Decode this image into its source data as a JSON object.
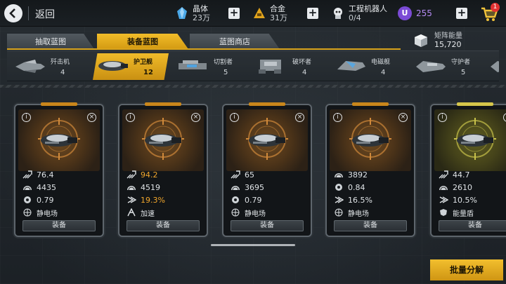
{
  "header": {
    "back_label": "返回",
    "crystal": {
      "name": "晶体",
      "value": "23万"
    },
    "alloy": {
      "name": "合金",
      "value": "31万"
    },
    "robots": {
      "name": "工程机器人",
      "value": "0/4"
    },
    "premium": {
      "letter": "U",
      "value": "255"
    },
    "cart_badge": "1"
  },
  "tabs": [
    {
      "label": "抽取蓝图"
    },
    {
      "label": "装备蓝图"
    },
    {
      "label": "蓝图商店"
    }
  ],
  "matrix_energy": {
    "name": "矩阵能量",
    "value": "15,720"
  },
  "ship_categories": [
    {
      "label": "歼击机",
      "count": "4"
    },
    {
      "label": "护卫舰",
      "count": "12"
    },
    {
      "label": "切割者",
      "count": "5"
    },
    {
      "label": "破坏者",
      "count": "4"
    },
    {
      "label": "电磁舰",
      "count": "4"
    },
    {
      "label": "守护者",
      "count": "5"
    }
  ],
  "cards": [
    {
      "stats": [
        {
          "icon": "attack-icon",
          "value": "76.4"
        },
        {
          "icon": "hull-icon",
          "value": "4435"
        },
        {
          "icon": "gear-icon",
          "value": "0.79"
        }
      ],
      "skill": "静电场",
      "equip": "装备"
    },
    {
      "stats": [
        {
          "icon": "attack-icon",
          "value": "94.2",
          "highlight": true
        },
        {
          "icon": "hull-icon",
          "value": "4519"
        },
        {
          "icon": "speed-icon",
          "value": "19.3%",
          "highlight": true
        }
      ],
      "skill": "加速",
      "equip": "装备"
    },
    {
      "stats": [
        {
          "icon": "attack-icon",
          "value": "65"
        },
        {
          "icon": "hull-icon",
          "value": "3695"
        },
        {
          "icon": "gear-icon",
          "value": "0.79"
        }
      ],
      "skill": "静电场",
      "equip": "装备"
    },
    {
      "stats": [
        {
          "icon": "hull-icon",
          "value": "3892"
        },
        {
          "icon": "gear-icon",
          "value": "0.84"
        },
        {
          "icon": "speed-icon",
          "value": "16.5%"
        }
      ],
      "skill": "静电场",
      "equip": "装备"
    },
    {
      "stats": [
        {
          "icon": "attack-icon",
          "value": "44.7"
        },
        {
          "icon": "hull-icon",
          "value": "2610"
        },
        {
          "icon": "speed-icon",
          "value": "10.5%"
        }
      ],
      "skill": "能量盾",
      "equip": "装备"
    }
  ],
  "batch_decompose_label": "批量分解",
  "colors": {
    "accent": "#e8ad1e",
    "highlight_stat": "#f1a62c",
    "premium": "#7b4bd6"
  }
}
